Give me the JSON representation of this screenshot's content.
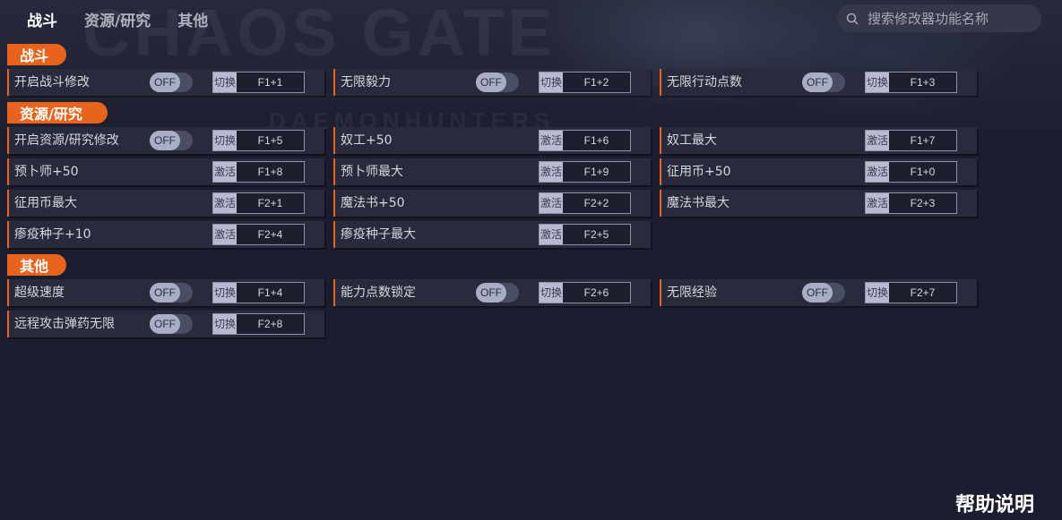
{
  "nav": {
    "tabs": [
      {
        "label": "战斗",
        "active": true
      },
      {
        "label": "资源/研究",
        "active": false
      },
      {
        "label": "其他",
        "active": false
      }
    ]
  },
  "search": {
    "placeholder": "搜索修改器功能名称"
  },
  "banner": {
    "title": "CHAOS GATE",
    "subtitle": "DAEMONHUNTERS"
  },
  "colors": {
    "accent": "#e8641c",
    "background": "#1c1e2f",
    "cell": "#292b3c"
  },
  "sections": [
    {
      "title": "战斗",
      "rows": [
        [
          {
            "label": "开启战斗修改",
            "toggle": "OFF",
            "action": "切换",
            "key": "F1+1"
          },
          {
            "label": "无限毅力",
            "toggle": "OFF",
            "action": "切换",
            "key": "F1+2"
          },
          {
            "label": "无限行动点数",
            "toggle": "OFF",
            "action": "切换",
            "key": "F1+3"
          }
        ]
      ]
    },
    {
      "title": "资源/研究",
      "rows": [
        [
          {
            "label": "开启资源/研究修改",
            "toggle": "OFF",
            "action": "切换",
            "key": "F1+5"
          },
          {
            "label": "奴工+50",
            "toggle": null,
            "action": "激活",
            "key": "F1+6"
          },
          {
            "label": "奴工最大",
            "toggle": null,
            "action": "激活",
            "key": "F1+7"
          }
        ],
        [
          {
            "label": "预卜师+50",
            "toggle": null,
            "action": "激活",
            "key": "F1+8"
          },
          {
            "label": "预卜师最大",
            "toggle": null,
            "action": "激活",
            "key": "F1+9"
          },
          {
            "label": "征用币+50",
            "toggle": null,
            "action": "激活",
            "key": "F1+0"
          }
        ],
        [
          {
            "label": "征用币最大",
            "toggle": null,
            "action": "激活",
            "key": "F2+1"
          },
          {
            "label": "魔法书+50",
            "toggle": null,
            "action": "激活",
            "key": "F2+2"
          },
          {
            "label": "魔法书最大",
            "toggle": null,
            "action": "激活",
            "key": "F2+3"
          }
        ],
        [
          {
            "label": "瘆疫种子+10",
            "toggle": null,
            "action": "激活",
            "key": "F2+4"
          },
          {
            "label": "瘆疫种子最大",
            "toggle": null,
            "action": "激活",
            "key": "F2+5"
          }
        ]
      ]
    },
    {
      "title": "其他",
      "rows": [
        [
          {
            "label": "超级速度",
            "toggle": "OFF",
            "action": "切换",
            "key": "F1+4"
          },
          {
            "label": "能力点数锁定",
            "toggle": "OFF",
            "action": "切换",
            "key": "F2+6"
          },
          {
            "label": "无限经验",
            "toggle": "OFF",
            "action": "切换",
            "key": "F2+7"
          }
        ],
        [
          {
            "label": "远程攻击弹药无限",
            "toggle": "OFF",
            "action": "切换",
            "key": "F2+8"
          }
        ]
      ]
    }
  ],
  "footer": {
    "help_label": "帮助说明"
  }
}
